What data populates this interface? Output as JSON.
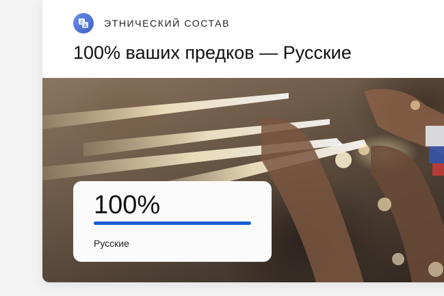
{
  "section": {
    "label": "ЭТНИЧЕСКИЙ СОСТАВ",
    "icon": "translate-icon"
  },
  "title": "100% ваших предков — Русские",
  "stat": {
    "percent_text": "100%",
    "percent_value": 100,
    "label": "Русские"
  },
  "colors": {
    "accent": "#1a5fd1",
    "icon_bg": "#4a6fd8",
    "text": "#111111"
  }
}
